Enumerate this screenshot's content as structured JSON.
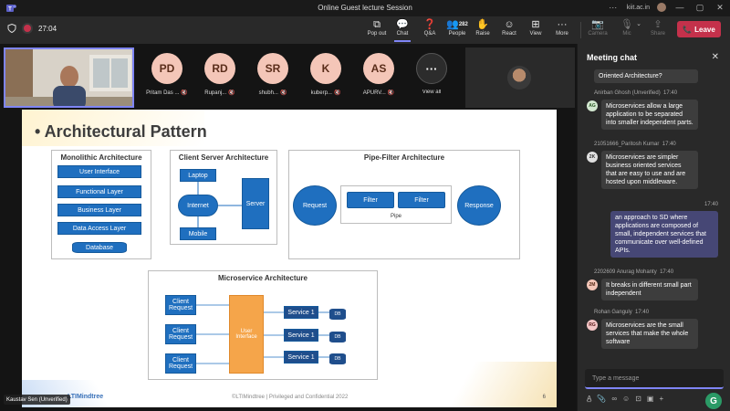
{
  "window": {
    "title": "Online Guest lecture Session",
    "account": "kiit.ac.in",
    "more_label": "···",
    "minimize": "—",
    "maximize": "▢",
    "close": "✕"
  },
  "toolbar": {
    "timer": "27:04",
    "buttons": [
      {
        "label": "Pop out",
        "icon": "pop-out-icon"
      },
      {
        "label": "Chat",
        "icon": "chat-icon"
      },
      {
        "label": "Q&A",
        "icon": "qa-icon"
      },
      {
        "label": "People",
        "icon": "people-icon"
      },
      {
        "label": "Raise",
        "icon": "raise-hand-icon"
      },
      {
        "label": "React",
        "icon": "react-icon"
      },
      {
        "label": "View",
        "icon": "view-icon"
      },
      {
        "label": "More",
        "icon": "more-icon"
      },
      {
        "label": "Camera",
        "icon": "camera-icon"
      },
      {
        "label": "Mic",
        "icon": "mic-icon"
      },
      {
        "label": "Share",
        "icon": "share-icon"
      }
    ],
    "people_count": "282",
    "leave_label": "Leave",
    "leave_color": "#c4314b",
    "accent_color": "#7f85f5"
  },
  "participants": [
    {
      "initials": "PD",
      "name": "Pritam Das ...",
      "color": "#f4c6b8"
    },
    {
      "initials": "RD",
      "name": "Rupanj...",
      "color": "#f4c6b8"
    },
    {
      "initials": "SR",
      "name": "shubh...",
      "color": "#f4c6b8"
    },
    {
      "initials": "K",
      "name": "kuberp...",
      "color": "#f4c6b8"
    },
    {
      "initials": "AS",
      "name": "APURV...",
      "color": "#f4c6b8"
    }
  ],
  "view_all": {
    "label": "View all",
    "icon": "···"
  },
  "presenter_name": "Kaustav Sen (Unverified)",
  "slide": {
    "title": "• Architectural Pattern",
    "monolithic": {
      "title": "Monolithic Architecture",
      "layers": [
        "User Interface",
        "Functional Layer",
        "Business Layer",
        "Data Access Layer"
      ],
      "database": "Database"
    },
    "client_server": {
      "title": "Client Server Architecture",
      "laptop": "Laptop",
      "internet": "Internet",
      "mobile": "Mobile",
      "server": "Server"
    },
    "pipe_filter": {
      "title": "Pipe-Filter Architecture",
      "request": "Request",
      "filter1": "Filter",
      "filter2": "Filter",
      "pipe": "Pipe",
      "response": "Response"
    },
    "microservice": {
      "title": "Microservice Architecture",
      "requests": [
        "Client Request",
        "Client Request",
        "Client Request"
      ],
      "ui": "User Interface",
      "services": [
        "Service 1",
        "Service 1",
        "Service 1"
      ],
      "dbs": [
        "DB",
        "DB",
        "DB"
      ]
    },
    "logo": "LTIMindtree",
    "footer": "©LTIMindtree | Privileged and Confidential 2022",
    "page": "6"
  },
  "chat": {
    "header": "Meeting chat",
    "messages": [
      {
        "sender": "",
        "time": "",
        "text": "Oriented Architecture?",
        "initials": "",
        "mine": false
      },
      {
        "sender": "Anirban Ghosh (Unverified)",
        "time": "17:40",
        "text": "Microservices allow a large application to be separated into smaller independent parts.",
        "initials": "AG",
        "avatar_color": "#d3e8d0",
        "mine": false
      },
      {
        "sender": "21051666_Paritosh Kumar",
        "time": "17:40",
        "text": "Microservices are simpler business oriented services that are easy to use and are hosted upon middleware.",
        "initials": "2K",
        "avatar_color": "#e0e0e0",
        "mine": false
      },
      {
        "sender": "",
        "time": "17:40",
        "text": "an approach to SD where applications are composed of small, independent services that communicate over well-defined APIs.",
        "initials": "",
        "mine": true
      },
      {
        "sender": "2202609 Anurag Mohanty",
        "time": "17:40",
        "text": "It breaks in different small part independent",
        "initials": "2M",
        "avatar_color": "#f4c6b8",
        "mine": false
      },
      {
        "sender": "Rohan Ganguly",
        "time": "17:40",
        "text": "Microservices are the small services that make the whole software",
        "initials": "RG",
        "avatar_color": "#f4c6c6",
        "mine": false
      }
    ],
    "compose_placeholder": "Type a message"
  }
}
